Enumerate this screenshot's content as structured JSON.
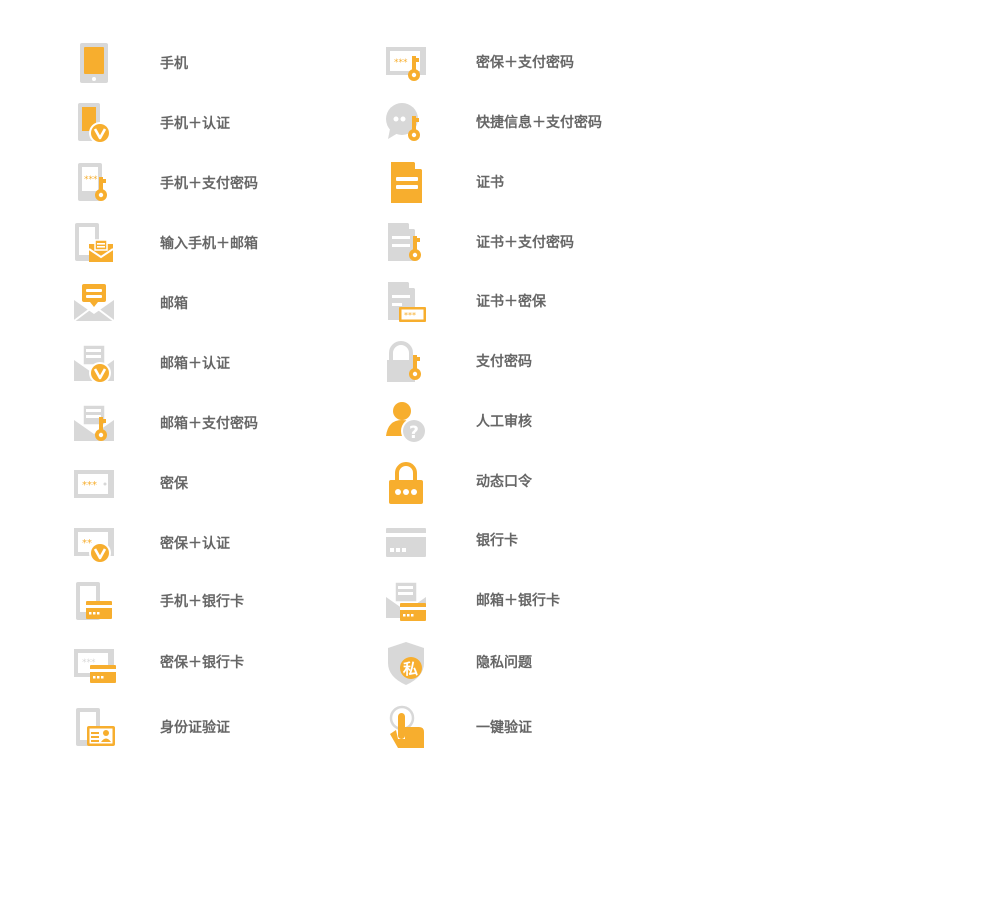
{
  "colors": {
    "accent": "#F7AE2E",
    "gray": "#D8D8D8",
    "label": "#666666"
  },
  "left_items": [
    {
      "label": "手机",
      "icon": "phone-icon"
    },
    {
      "label": "手机＋认证",
      "icon": "phone-verify-icon"
    },
    {
      "label": "手机＋支付密码",
      "icon": "phone-paykey-icon"
    },
    {
      "label": "输入手机＋邮箱",
      "icon": "phone-email-icon"
    },
    {
      "label": "邮箱",
      "icon": "email-icon"
    },
    {
      "label": "邮箱＋认证",
      "icon": "email-verify-icon"
    },
    {
      "label": "邮箱＋支付密码",
      "icon": "email-paykey-icon"
    },
    {
      "label": "密保",
      "icon": "security-question-icon"
    },
    {
      "label": "密保＋认证",
      "icon": "security-verify-icon"
    },
    {
      "label": "手机＋银行卡",
      "icon": "phone-bankcard-icon"
    },
    {
      "label": "密保＋银行卡",
      "icon": "security-bankcard-icon"
    },
    {
      "label": "身份证验证",
      "icon": "id-card-icon"
    }
  ],
  "right_items": [
    {
      "label": "密保＋支付密码",
      "icon": "security-paykey-icon"
    },
    {
      "label": "快捷信息＋支付密码",
      "icon": "quickinfo-paykey-icon"
    },
    {
      "label": "证书",
      "icon": "certificate-icon"
    },
    {
      "label": "证书＋支付密码",
      "icon": "certificate-paykey-icon"
    },
    {
      "label": "证书＋密保",
      "icon": "certificate-security-icon"
    },
    {
      "label": "支付密码",
      "icon": "paykey-lock-icon"
    },
    {
      "label": "人工审核",
      "icon": "manual-review-icon"
    },
    {
      "label": "动态口令",
      "icon": "dynamic-token-icon"
    },
    {
      "label": "银行卡",
      "icon": "bankcard-icon"
    },
    {
      "label": "邮箱＋银行卡",
      "icon": "email-bankcard-icon"
    },
    {
      "label": "隐私问题",
      "icon": "privacy-question-icon",
      "badge": "私"
    },
    {
      "label": "一键验证",
      "icon": "one-click-verify-icon"
    }
  ]
}
